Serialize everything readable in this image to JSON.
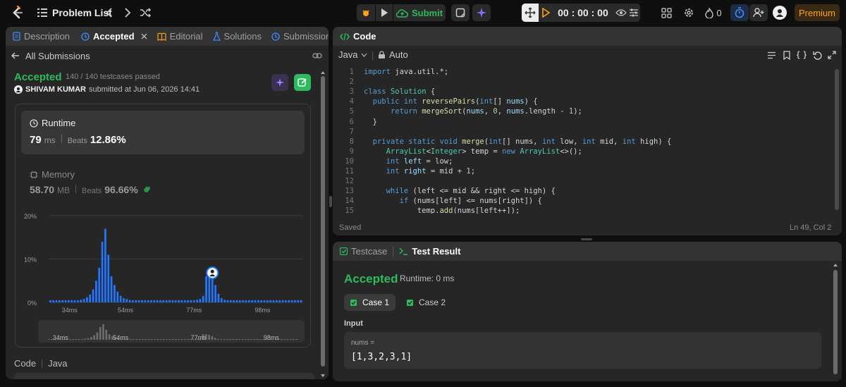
{
  "topbar": {
    "problem_list": "Problem List",
    "submit": "Submit",
    "timer": "00 : 00 : 00",
    "streak": "0",
    "premium": "Premium"
  },
  "left": {
    "tabs": [
      {
        "label": "Description"
      },
      {
        "label": "Accepted"
      },
      {
        "label": "Editorial"
      },
      {
        "label": "Solutions"
      },
      {
        "label": "Submissions"
      }
    ],
    "back": "All Submissions",
    "status": "Accepted",
    "testcases": "140 / 140 testcases passed",
    "user": "SHIVAM KUMAR",
    "submitted_at": "submitted at Jun 06, 2026 14:41",
    "runtime": {
      "title": "Runtime",
      "value": "79",
      "unit": "ms",
      "beats_label": "Beats",
      "beats": "12.86%"
    },
    "memory": {
      "title": "Memory",
      "value": "58.70",
      "unit": "MB",
      "beats_label": "Beats",
      "beats": "96.66%"
    },
    "code_label": "Code",
    "lang": "Java"
  },
  "chart_data": {
    "type": "bar",
    "yticks": [
      "20%",
      "10%",
      "0%"
    ],
    "ylim": [
      0,
      20
    ],
    "xticks": [
      "34ms",
      "54ms",
      "77ms",
      "98ms"
    ],
    "values": [
      0.5,
      0.5,
      0.5,
      0.5,
      0.5,
      0.5,
      0.5,
      0.5,
      0.5,
      0.5,
      0.6,
      0.8,
      1.2,
      1.8,
      3,
      5,
      8,
      14,
      17,
      11,
      6,
      4,
      2.5,
      1.5,
      1,
      0.8,
      0.6,
      0.5,
      0.5,
      0.5,
      0.5,
      0.5,
      0.5,
      0.5,
      0.5,
      0.5,
      0.5,
      0.5,
      0.5,
      0.5,
      0.5,
      0.5,
      0.5,
      0.5,
      0.5,
      0.5,
      0.5,
      0.5,
      0.6,
      0.8,
      1.5,
      6,
      6,
      5.5,
      4,
      2,
      1,
      0.6,
      0.5,
      0.5,
      0.5,
      0.5,
      0.5,
      0.5,
      0.5,
      0.5,
      0.5,
      0.5,
      0.5,
      0.5,
      0.5,
      0.5,
      0.5,
      0.5,
      0.5,
      0.5,
      0.5,
      0.5,
      0.5,
      0.5,
      0.5,
      0.5,
      0.5
    ],
    "highlight_index": 53,
    "color": "#2576ff"
  },
  "code": {
    "title": "Code",
    "language": "Java",
    "auto": "Auto",
    "lines": [
      {
        "n": "1",
        "t": [
          [
            "kw",
            "import"
          ],
          [
            "pl",
            " java.util.*;"
          ]
        ]
      },
      {
        "n": "2",
        "t": []
      },
      {
        "n": "3",
        "t": [
          [
            "kw",
            "class"
          ],
          [
            "pl",
            " "
          ],
          [
            "ty",
            "Solution"
          ],
          [
            "pl",
            " {"
          ]
        ]
      },
      {
        "n": "4",
        "t": [
          [
            "pl",
            "  "
          ],
          [
            "kw",
            "public"
          ],
          [
            "pl",
            " "
          ],
          [
            "kw",
            "int"
          ],
          [
            "pl",
            " "
          ],
          [
            "fn",
            "reversePairs"
          ],
          [
            "pl",
            "("
          ],
          [
            "kw",
            "int"
          ],
          [
            "pl",
            "[] "
          ],
          [
            "vr",
            "nums"
          ],
          [
            "pl",
            ") {"
          ]
        ]
      },
      {
        "n": "5",
        "t": [
          [
            "pl",
            "      "
          ],
          [
            "kw",
            "return"
          ],
          [
            "pl",
            " "
          ],
          [
            "fn",
            "mergeSort"
          ],
          [
            "pl",
            "("
          ],
          [
            "vr",
            "nums"
          ],
          [
            "pl",
            ", "
          ],
          [
            "nm",
            "0"
          ],
          [
            "pl",
            ", "
          ],
          [
            "vr",
            "nums"
          ],
          [
            "pl",
            ".length - "
          ],
          [
            "nm",
            "1"
          ],
          [
            "pl",
            ");"
          ]
        ]
      },
      {
        "n": "6",
        "t": [
          [
            "pl",
            "  }"
          ]
        ]
      },
      {
        "n": "7",
        "t": []
      },
      {
        "n": "8",
        "t": [
          [
            "pl",
            "  "
          ],
          [
            "kw",
            "private"
          ],
          [
            "pl",
            " "
          ],
          [
            "kw",
            "static"
          ],
          [
            "pl",
            " "
          ],
          [
            "kw",
            "void"
          ],
          [
            "pl",
            " "
          ],
          [
            "fn",
            "merge"
          ],
          [
            "pl",
            "("
          ],
          [
            "kw",
            "int"
          ],
          [
            "pl",
            "[] nums, "
          ],
          [
            "kw",
            "int"
          ],
          [
            "pl",
            " low, "
          ],
          [
            "kw",
            "int"
          ],
          [
            "pl",
            " mid, "
          ],
          [
            "kw",
            "int"
          ],
          [
            "pl",
            " high) {"
          ]
        ]
      },
      {
        "n": "9",
        "t": [
          [
            "pl",
            "     "
          ],
          [
            "ty",
            "ArrayList"
          ],
          [
            "pl",
            "<"
          ],
          [
            "ty",
            "Integer"
          ],
          [
            "pl",
            "> temp = "
          ],
          [
            "kw",
            "new"
          ],
          [
            "pl",
            " "
          ],
          [
            "ty",
            "ArrayList"
          ],
          [
            "pl",
            "<>();"
          ]
        ]
      },
      {
        "n": "10",
        "t": [
          [
            "pl",
            "     "
          ],
          [
            "kw",
            "int"
          ],
          [
            "pl",
            " "
          ],
          [
            "vr",
            "left"
          ],
          [
            "pl",
            " = low;"
          ]
        ]
      },
      {
        "n": "11",
        "t": [
          [
            "pl",
            "     "
          ],
          [
            "kw",
            "int"
          ],
          [
            "pl",
            " "
          ],
          [
            "vr",
            "right"
          ],
          [
            "pl",
            " = mid + "
          ],
          [
            "nm",
            "1"
          ],
          [
            "pl",
            ";"
          ]
        ]
      },
      {
        "n": "12",
        "t": []
      },
      {
        "n": "13",
        "t": [
          [
            "pl",
            "     "
          ],
          [
            "kw",
            "while"
          ],
          [
            "pl",
            " (left <= mid && right <= high) {"
          ]
        ]
      },
      {
        "n": "14",
        "t": [
          [
            "pl",
            "        "
          ],
          [
            "kw",
            "if"
          ],
          [
            "pl",
            " (nums[left] <= nums[right]) {"
          ]
        ]
      },
      {
        "n": "15",
        "t": [
          [
            "pl",
            "            temp."
          ],
          [
            "fn",
            "add"
          ],
          [
            "pl",
            "(nums[left++]);"
          ]
        ]
      }
    ],
    "saved": "Saved",
    "position": "Ln 49, Col 2"
  },
  "result": {
    "tab_testcase": "Testcase",
    "tab_result": "Test Result",
    "status": "Accepted",
    "runtime": "Runtime: 0 ms",
    "case1": "Case 1",
    "case2": "Case 2",
    "input_label": "Input",
    "var_name": "nums =",
    "var_value": "[1,3,2,3,1]"
  }
}
